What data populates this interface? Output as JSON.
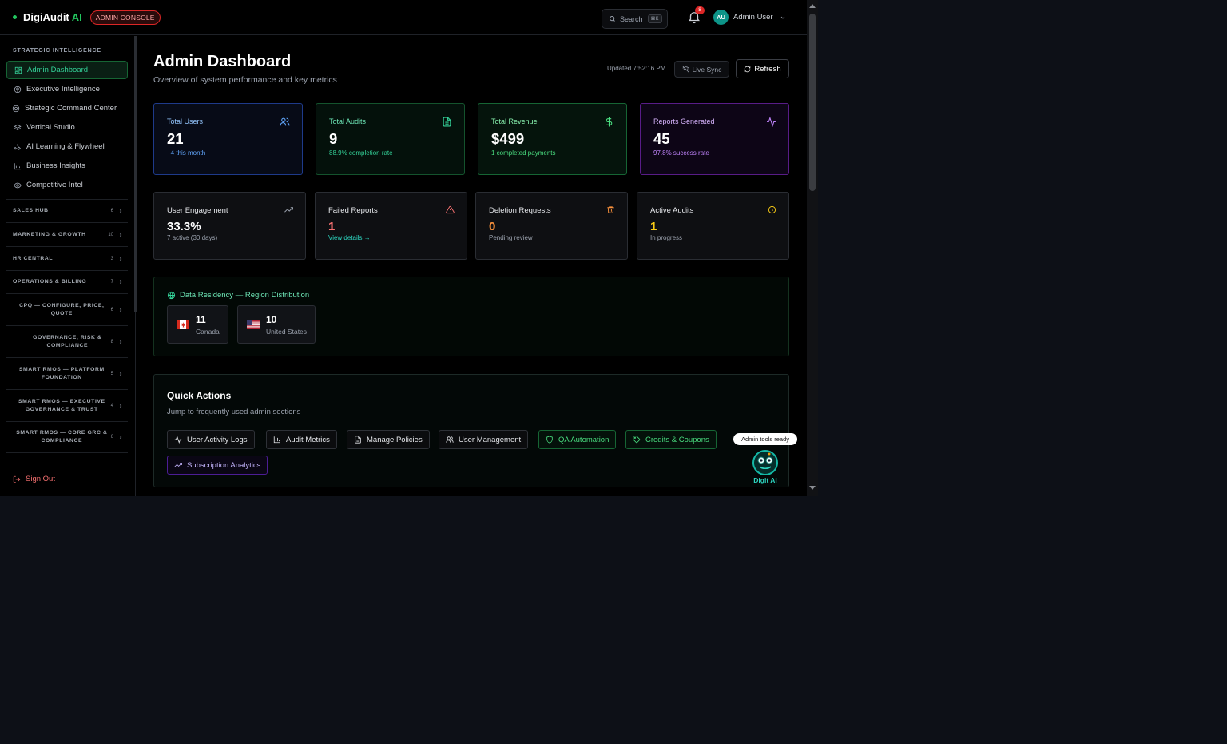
{
  "brand": {
    "name": "DigiAudit",
    "suffix": "AI",
    "badge": "ADMIN CONSOLE"
  },
  "topbar": {
    "search_label": "Search",
    "search_shortcut": "⌘K",
    "notification_count": "8",
    "user_initials": "AU",
    "user_name": "Admin User"
  },
  "sidebar": {
    "group_title": "STRATEGIC INTELLIGENCE",
    "items": [
      {
        "label": "Admin Dashboard",
        "icon": "grid-icon",
        "active": true
      },
      {
        "label": "Executive Intelligence",
        "icon": "brain-icon"
      },
      {
        "label": "Strategic Command Center",
        "icon": "target-icon"
      },
      {
        "label": "Vertical Studio",
        "icon": "layers-icon"
      },
      {
        "label": "AI Learning & Flywheel",
        "icon": "sparkles-icon"
      },
      {
        "label": "Business Insights",
        "icon": "bar-chart-icon"
      },
      {
        "label": "Competitive Intel",
        "icon": "eye-icon"
      }
    ],
    "sections": [
      {
        "label": "SALES HUB",
        "count": "6"
      },
      {
        "label": "MARKETING & GROWTH",
        "count": "10"
      },
      {
        "label": "HR CENTRAL",
        "count": "3"
      },
      {
        "label": "OPERATIONS & BILLING",
        "count": "7"
      },
      {
        "label": "CPQ — CONFIGURE, PRICE, QUOTE",
        "count": "6"
      },
      {
        "label": "GOVERNANCE, RISK & COMPLIANCE",
        "count": "8"
      },
      {
        "label": "SMART RMOS — PLATFORM FOUNDATION",
        "count": "5"
      },
      {
        "label": "SMART RMOS — EXECUTIVE GOVERNANCE & TRUST",
        "count": "4"
      },
      {
        "label": "SMART RMOS — CORE GRC & COMPLIANCE",
        "count": "6"
      }
    ],
    "sign_out": "Sign Out"
  },
  "header": {
    "title": "Admin Dashboard",
    "subtitle": "Overview of system performance and key metrics",
    "updated": "Updated 7:52:16 PM",
    "live_sync": "Live Sync",
    "refresh": "Refresh"
  },
  "stats_primary": [
    {
      "label": "Total Users",
      "value": "21",
      "sub": "+4 this month",
      "icon": "users-icon"
    },
    {
      "label": "Total Audits",
      "value": "9",
      "sub": "88.9% completion rate",
      "icon": "file-text-icon"
    },
    {
      "label": "Total Revenue",
      "value": "$499",
      "sub": "1 completed payments",
      "icon": "dollar-icon"
    },
    {
      "label": "Reports Generated",
      "value": "45",
      "sub": "97.8% success rate",
      "icon": "activity-icon"
    }
  ],
  "stats_secondary": [
    {
      "label": "User Engagement",
      "value": "33.3%",
      "sub": "7 active (30 days)",
      "icon": "trending-up-icon",
      "value_color": "#ffffff"
    },
    {
      "label": "Failed Reports",
      "value": "1",
      "sub": "View details →",
      "icon": "alert-triangle-icon",
      "value_color": "#f87171"
    },
    {
      "label": "Deletion Requests",
      "value": "0",
      "sub": "Pending review",
      "icon": "trash-icon",
      "value_color": "#fb923c"
    },
    {
      "label": "Active Audits",
      "value": "1",
      "sub": "In progress",
      "icon": "clock-icon",
      "value_color": "#facc15"
    }
  ],
  "regions": {
    "title": "Data Residency — Region Distribution",
    "items": [
      {
        "count": "11",
        "name": "Canada",
        "flag": "canada-flag"
      },
      {
        "count": "10",
        "name": "United States",
        "flag": "us-flag"
      }
    ]
  },
  "quick_actions": {
    "title": "Quick Actions",
    "subtitle": "Jump to frequently used admin sections",
    "buttons": [
      {
        "label": "User Activity Logs",
        "icon": "activity-icon"
      },
      {
        "label": "Audit Metrics",
        "icon": "bar-chart-icon"
      },
      {
        "label": "Manage Policies",
        "icon": "file-text-icon"
      },
      {
        "label": "User Management",
        "icon": "users-icon"
      },
      {
        "label": "QA Automation",
        "icon": "shield-icon"
      },
      {
        "label": "Credits & Coupons",
        "icon": "tag-icon"
      },
      {
        "label": "Subscription Analytics",
        "icon": "trending-up-icon"
      }
    ]
  },
  "assistant": {
    "tooltip": "Admin tools ready",
    "name": "Digit AI"
  },
  "colors": {
    "accent": "#22c55e",
    "danger": "#dc2626",
    "teal": "#0d9488"
  }
}
